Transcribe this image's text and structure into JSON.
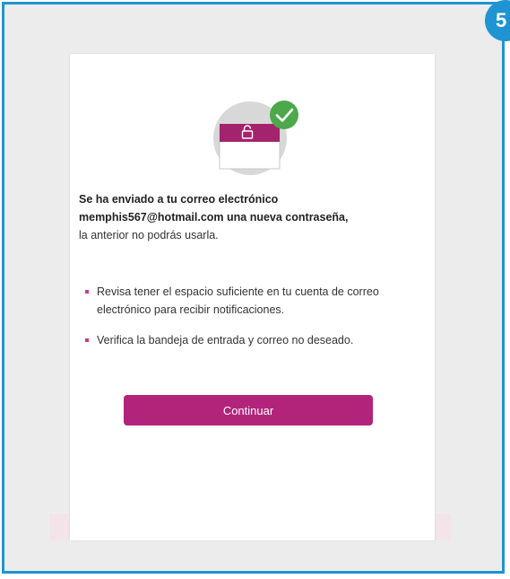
{
  "step_badge": "5",
  "message": {
    "line1": "Se ha enviado a tu correo electrónico",
    "line2": "memphis567@hotmail.com una nueva contraseña,",
    "line3": "la anterior no podrás usarla."
  },
  "tips": [
    "Revisa tener el espacio suficiente en tu cuenta de correo electrónico para recibir notificaciones.",
    "Verifica la bandeja de entrada y correo no deseado."
  ],
  "continue_label": "Continuar",
  "colors": {
    "frame_border": "#1e94d3",
    "primary_button": "#b2237a",
    "bullet": "#d03a83",
    "check_badge": "#4ca84a",
    "envelope_lock": "#a4236d"
  },
  "icons": {
    "illustration": "envelope-lock-icon",
    "check": "checkmark-icon"
  }
}
